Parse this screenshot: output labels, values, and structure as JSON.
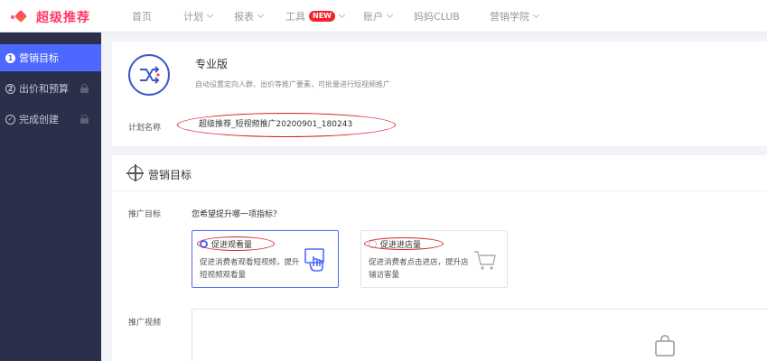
{
  "brand": {
    "name": "超级推荐"
  },
  "nav": {
    "items": [
      {
        "label": "首页",
        "dropdown": false
      },
      {
        "label": "计划",
        "dropdown": true
      },
      {
        "label": "报表",
        "dropdown": true
      },
      {
        "label": "工具",
        "dropdown": true,
        "badge": "NEW"
      },
      {
        "label": "账户",
        "dropdown": true
      },
      {
        "label": "妈妈CLUB",
        "dropdown": false
      },
      {
        "label": "营销学院",
        "dropdown": true
      }
    ]
  },
  "sidebar": {
    "steps": [
      {
        "index": "1",
        "label": "营销目标",
        "active": true,
        "locked": false
      },
      {
        "index": "2",
        "label": "出价和预算",
        "active": false,
        "locked": true
      },
      {
        "index": "✓",
        "label": "完成创建",
        "active": false,
        "locked": true
      }
    ]
  },
  "plan": {
    "edition_title": "专业版",
    "edition_desc": "自动设置定向人群、出价等推广要素，可批量进行短视频推广",
    "name_label": "计划名称",
    "name_value": "超级推荐_短视频推广20200901_180243"
  },
  "goal": {
    "section_title": "营销目标",
    "target_label": "推广目标",
    "question": "您希望提升哪一项指标？",
    "options": [
      {
        "title": "促进观看量",
        "desc": "促进消费者观看短视频，提升短视频观看量",
        "selected": true,
        "icon": "hand-tap-icon"
      },
      {
        "title": "促进进店量",
        "desc": "促进消费者点击进店，提升店铺访客量",
        "selected": false,
        "icon": "cart-icon"
      }
    ],
    "video_label": "推广视频"
  },
  "colors": {
    "accent": "#4c68ff",
    "sidebar_bg": "#2b2f49",
    "brand": "#ff3a6a",
    "annotation": "#d6202a"
  }
}
